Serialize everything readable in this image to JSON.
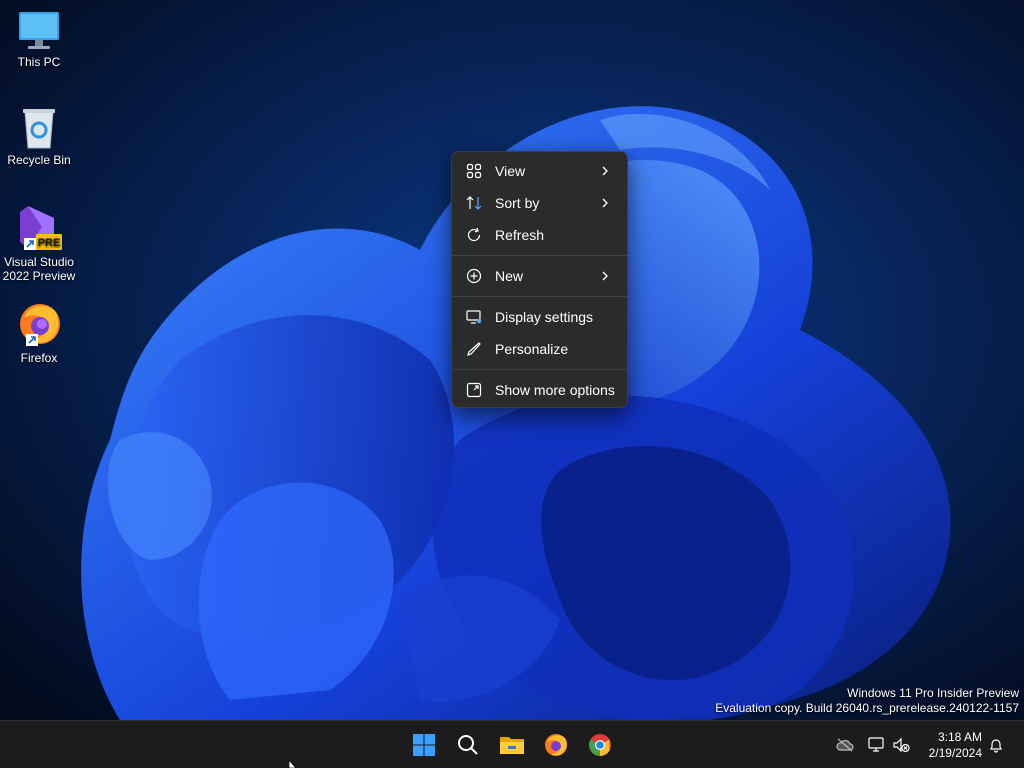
{
  "desktop": {
    "icons": [
      {
        "label": "This PC",
        "icon": "monitor-icon"
      },
      {
        "label": "Recycle Bin",
        "icon": "recycle-bin-icon"
      },
      {
        "label": "Visual Studio\n2022 Preview",
        "line1": "Visual Studio",
        "line2": "2022 Preview",
        "badge": "PRE",
        "icon": "visual-studio-icon"
      },
      {
        "label": "Firefox",
        "icon": "firefox-icon"
      }
    ]
  },
  "context_menu": {
    "items": [
      {
        "label": "View",
        "icon": "grid-icon",
        "submenu": true
      },
      {
        "label": "Sort by",
        "icon": "sort-icon",
        "submenu": true
      },
      {
        "label": "Refresh",
        "icon": "refresh-icon",
        "submenu": false
      },
      {
        "label": "New",
        "icon": "plus-circle-icon",
        "submenu": true
      },
      {
        "label": "Display settings",
        "icon": "display-settings-icon",
        "submenu": false
      },
      {
        "label": "Personalize",
        "icon": "pen-icon",
        "submenu": false
      },
      {
        "label": "Show more options",
        "icon": "expand-icon",
        "submenu": false
      }
    ]
  },
  "watermark": {
    "line1": "Windows 11 Pro Insider Preview",
    "line2": "Evaluation copy. Build 26040.rs_prerelease.240122-1157"
  },
  "taskbar": {
    "apps": [
      "start-icon",
      "search-icon",
      "file-explorer-icon",
      "firefox-icon",
      "chrome-icon"
    ],
    "tray": [
      "cloud-off-icon",
      "network-icon",
      "volume-muted-icon"
    ],
    "time": "3:18 AM",
    "date": "2/19/2024"
  },
  "colors": {
    "menu_bg": "#2b2b2b",
    "taskbar_bg": "#1c1c1c",
    "accent": "#1f6fff"
  }
}
